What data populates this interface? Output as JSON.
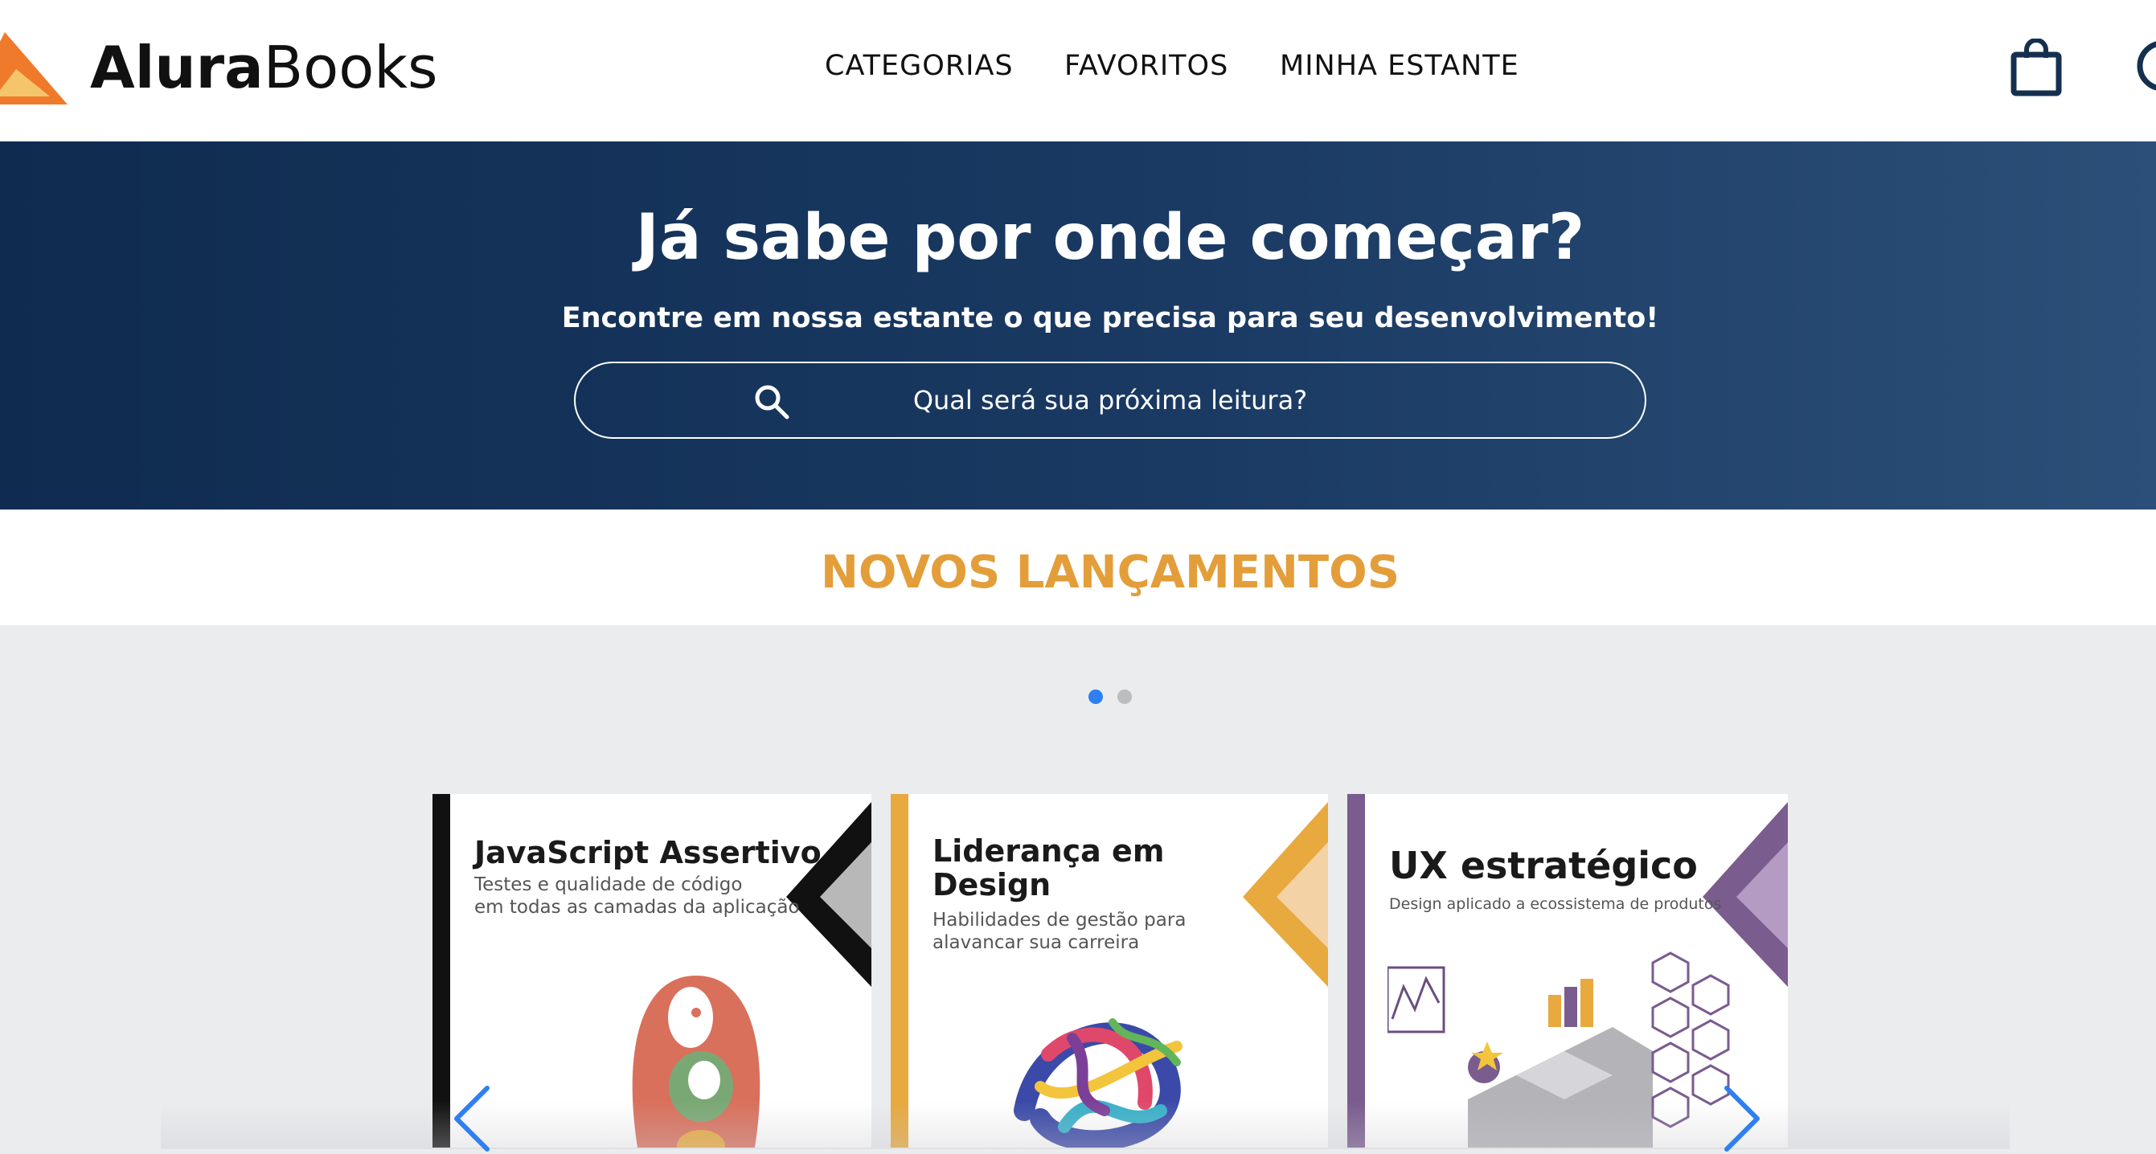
{
  "header": {
    "brand_part1": "Alura",
    "brand_part2": "Books",
    "nav": [
      "CATEGORIAS",
      "FAVORITOS",
      "MINHA ESTANTE"
    ],
    "icons": {
      "bag": "shopping-bag-icon",
      "user": "user-icon",
      "logo": "alura-triangle-logo"
    }
  },
  "hero": {
    "title": "Já sabe por onde começar?",
    "subtitle": "Encontre em nossa estante o que precisa para seu desenvolvimento!",
    "search_placeholder": "Qual será sua próxima leitura?"
  },
  "section": {
    "title": "NOVOS LANÇAMENTOS"
  },
  "carousel": {
    "dots": [
      {
        "active": true
      },
      {
        "active": false
      }
    ],
    "books": [
      {
        "title": "JavaScript Assertivo",
        "subtitle_line1": "Testes e qualidade de código",
        "subtitle_line2": "em todas as camadas da aplicação",
        "accent": "#111111"
      },
      {
        "title_line1": "Liderança em",
        "title_line2": "Design",
        "subtitle_line1": "Habilidades de gestão para",
        "subtitle_line2": "alavancar sua carreira",
        "accent": "#e8a93f"
      },
      {
        "title": "UX estratégico",
        "subtitle_line1": "Design aplicado a ecossistema de produtos",
        "accent": "#7a5c8e"
      }
    ]
  },
  "colors": {
    "hero_bg": "#0f2b4f",
    "section_title": "#e39e3a",
    "dot_active": "#2f7ff2",
    "arrow": "#2f7ff2"
  }
}
